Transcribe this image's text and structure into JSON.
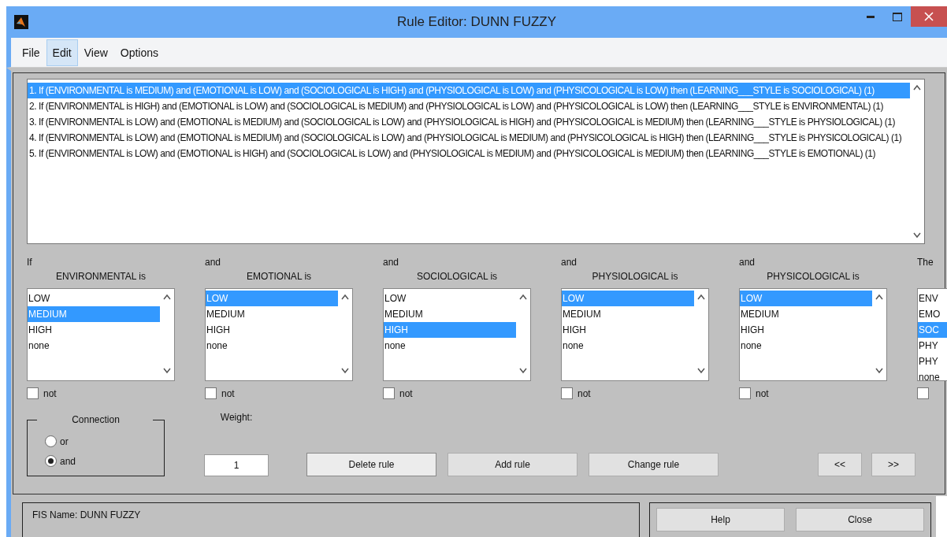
{
  "window": {
    "title": "Rule Editor: DUNN FUZZY"
  },
  "menu": [
    {
      "label": "File",
      "selected": false
    },
    {
      "label": "Edit",
      "selected": true
    },
    {
      "label": "View",
      "selected": false
    },
    {
      "label": "Options",
      "selected": false
    }
  ],
  "rules": [
    {
      "text": "1. If (ENVIRONMENTAL is MEDIUM) and (EMOTIONAL is LOW) and (SOCIOLOGICAL is HIGH) and (PHYSIOLOGICAL is LOW) and (PHYSICOLOGICAL is LOW) then (LEARNING___STYLE is SOCIOLOGICAL) (1)",
      "selected": true
    },
    {
      "text": "2. If (ENVIRONMENTAL is HIGH) and (EMOTIONAL is LOW) and (SOCIOLOGICAL is MEDIUM) and (PHYSIOLOGICAL is LOW) and (PHYSICOLOGICAL is LOW) then (LEARNING___STYLE is ENVIRONMENTAL) (1)",
      "selected": false
    },
    {
      "text": "3. If (ENVIRONMENTAL is LOW) and (EMOTIONAL is MEDIUM) and (SOCIOLOGICAL is LOW) and (PHYSIOLOGICAL is HIGH) and (PHYSICOLOGICAL is MEDIUM) then (LEARNING___STYLE is PHYSIOLOGICAL) (1)",
      "selected": false
    },
    {
      "text": "4. If (ENVIRONMENTAL is LOW) and (EMOTIONAL is MEDIUM) and (SOCIOLOGICAL is LOW) and (PHYSIOLOGICAL is MEDIUM) and (PHYSICOLOGICAL is HIGH) then (LEARNING___STYLE is PHYSICOLOGICAL) (1)",
      "selected": false
    },
    {
      "text": "5. If (ENVIRONMENTAL is LOW) and (EMOTIONAL is HIGH) and (SOCIOLOGICAL is LOW) and (PHYSIOLOGICAL is MEDIUM) and (PHYSICOLOGICAL is MEDIUM) then (LEARNING___STYLE is EMOTIONAL) (1)",
      "selected": false
    }
  ],
  "variables": [
    {
      "connector": "If",
      "label": "ENVIRONMENTAL is",
      "not": {
        "label": "not",
        "checked": false
      },
      "options": [
        {
          "text": "LOW",
          "selected": false
        },
        {
          "text": "MEDIUM",
          "selected": true
        },
        {
          "text": "HIGH",
          "selected": false
        },
        {
          "text": "none",
          "selected": false
        }
      ]
    },
    {
      "connector": "and",
      "label": "EMOTIONAL is",
      "not": {
        "label": "not",
        "checked": false
      },
      "options": [
        {
          "text": "LOW",
          "selected": true
        },
        {
          "text": "MEDIUM",
          "selected": false
        },
        {
          "text": "HIGH",
          "selected": false
        },
        {
          "text": "none",
          "selected": false
        }
      ]
    },
    {
      "connector": "and",
      "label": "SOCIOLOGICAL is",
      "not": {
        "label": "not",
        "checked": false
      },
      "options": [
        {
          "text": "LOW",
          "selected": false
        },
        {
          "text": "MEDIUM",
          "selected": false
        },
        {
          "text": "HIGH",
          "selected": true
        },
        {
          "text": "none",
          "selected": false
        }
      ]
    },
    {
      "connector": "and",
      "label": "PHYSIOLOGICAL is",
      "not": {
        "label": "not",
        "checked": false
      },
      "options": [
        {
          "text": "LOW",
          "selected": true
        },
        {
          "text": "MEDIUM",
          "selected": false
        },
        {
          "text": "HIGH",
          "selected": false
        },
        {
          "text": "none",
          "selected": false
        }
      ]
    },
    {
      "connector": "and",
      "label": "PHYSICOLOGICAL is",
      "not": {
        "label": "not",
        "checked": false
      },
      "options": [
        {
          "text": "LOW",
          "selected": true
        },
        {
          "text": "MEDIUM",
          "selected": false
        },
        {
          "text": "HIGH",
          "selected": false
        },
        {
          "text": "none",
          "selected": false
        }
      ]
    },
    {
      "connector": "The",
      "not": {
        "checked": false
      },
      "options": [
        {
          "text": "ENV",
          "selected": false
        },
        {
          "text": "EMO",
          "selected": false
        },
        {
          "text": "SOC",
          "selected": true
        },
        {
          "text": "PHY",
          "selected": false
        },
        {
          "text": "PHY",
          "selected": false
        },
        {
          "text": "none",
          "selected": false
        }
      ]
    }
  ],
  "connection": {
    "title": "Connection",
    "options": [
      {
        "label": "or",
        "selected": false
      },
      {
        "label": "and",
        "selected": true
      }
    ]
  },
  "weight": {
    "label": "Weight:",
    "value": "1"
  },
  "buttons": [
    {
      "label": "Delete rule",
      "focused": true
    },
    {
      "label": "Add rule",
      "focused": false
    },
    {
      "label": "Change rule",
      "focused": false
    }
  ],
  "nav_buttons": [
    {
      "label": "<<"
    },
    {
      "label": ">>"
    }
  ],
  "status": "FIS Name: DUNN FUZZY",
  "footer_buttons": [
    {
      "label": "Help"
    },
    {
      "label": "Close"
    }
  ]
}
